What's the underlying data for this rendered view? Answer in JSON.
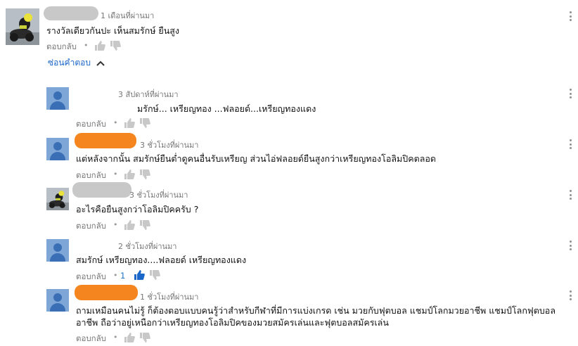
{
  "comments": [
    {
      "time": "1 เดือนที่ผ่านมา",
      "text": "รางวัลเดียวกันปะ เห็นสมรักษ์ ยืนสูง",
      "reply_label": "ตอบกลับ",
      "dot": "•",
      "avatar_icon": "user-photo-icon"
    },
    {
      "time": "3 สัปดาห์ที่ผ่านมา",
      "text": "มรักษ์... เหรียญทอง ...ฟลอยด์...เหรียญทองแดง",
      "reply_label": "ตอบกลับ",
      "dot": "•",
      "avatar_icon": "default-avatar-icon"
    },
    {
      "time": "3 ชั่วโมงที่ผ่านมา",
      "text": "แต่หลังจากนั้น สมรักษ์ยืนต่ำดูคนอื่นรับเหรียญ ส่วนไอ่ฟลอยด์ยืนสูงกว่าเหรียญทองโอลิมปิคตลอด",
      "reply_label": "ตอบกลับ",
      "dot": "•",
      "avatar_icon": "default-avatar-icon"
    },
    {
      "time": "3 ชั่วโมงที่ผ่านมา",
      "text": "อะไรคือยืนสูงกว่าโอลิมปิคครับ ?",
      "reply_label": "ตอบกลับ",
      "dot": "•",
      "avatar_icon": "user-photo-icon"
    },
    {
      "time": "2 ชั่วโมงที่ผ่านมา",
      "text": "สมรักษ์ เหรียญทอง....ฟลอยด์  เหรียญทองแดง",
      "reply_label": "ตอบกลับ",
      "dot": "•",
      "like_count": "1",
      "avatar_icon": "default-avatar-icon"
    },
    {
      "time": "1 ชั่วโมงที่ผ่านมา",
      "text_line1": "ถามเหมือนคนไม่รู้ ก็ต้องตอบแบบคนรู้ว่าสำหรับกีฬาที่มีการแบ่งเกรด เช่น มวยกับฟุตบอล แชมป์โลกมวยอาชีพ แชมป์โลกฟุตบอล",
      "text_line2": "อาชีพ ถือว่าอยู่เหนือกว่าเหรียญทองโอลิมปิคของมวยสมัครเล่นและฟุตบอลสมัครเล่น",
      "reply_label": "ตอบกลับ",
      "dot": "•",
      "avatar_icon": "default-avatar-icon"
    }
  ],
  "hide_replies_label": "ซ่อนคำตอบ",
  "colors": {
    "link_blue": "#1a66c9",
    "redaction_gray": "#c8c8c8",
    "redaction_orange": "#f5861f",
    "avatar_blue": "#7ea7d8"
  }
}
